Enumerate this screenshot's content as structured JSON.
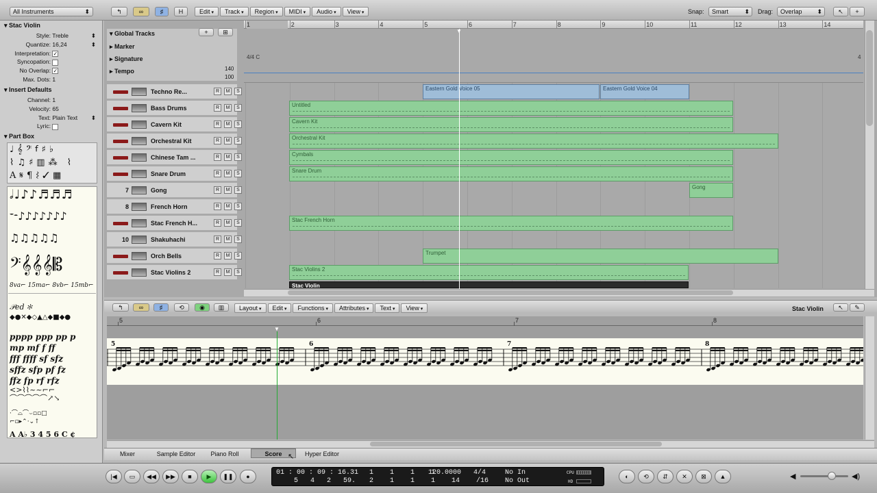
{
  "top": {
    "instruments": "All Instruments",
    "buttons": [
      "H"
    ],
    "menus": [
      "Edit",
      "Track",
      "Region",
      "MIDI",
      "Audio",
      "View"
    ],
    "snap_label": "Snap:",
    "snap": "Smart",
    "drag_label": "Drag:",
    "drag": "Overlap"
  },
  "inspector": {
    "title": "Stac Violin",
    "style_label": "Style:",
    "style": "Treble",
    "quantize_label": "Quantize:",
    "quantize": "16,24",
    "interp_label": "Interpretation:",
    "sync_label": "Syncopation:",
    "nooverlap_label": "No Overlap:",
    "maxdots_label": "Max. Dots:",
    "maxdots": "1",
    "insert_title": "Insert Defaults",
    "channel_label": "Channel:",
    "channel": "1",
    "velocity_label": "Velocity:",
    "velocity": "65",
    "text_label": "Text:",
    "text": "Plain Text",
    "lyric_label": "Lyric:",
    "partbox_title": "Part Box"
  },
  "arrange": {
    "global_tracks": "Global Tracks",
    "marker": "Marker",
    "signature": "Signature",
    "sig_value": "4/4 C",
    "sig_end": "4",
    "tempo": "Tempo",
    "tempo_hi": "140",
    "tempo_lo": "100",
    "ruler": [
      "1",
      "2",
      "3",
      "4",
      "5",
      "6",
      "7",
      "8",
      "9",
      "10",
      "11",
      "12",
      "13",
      "14"
    ],
    "tracks": [
      {
        "num": "",
        "name": "Techno Re..."
      },
      {
        "num": "",
        "name": "Bass Drums"
      },
      {
        "num": "",
        "name": "Cavern Kit"
      },
      {
        "num": "",
        "name": "Orchestral Kit"
      },
      {
        "num": "",
        "name": "Chinese Tam ..."
      },
      {
        "num": "",
        "name": "Snare Drum"
      },
      {
        "num": "7",
        "name": "Gong"
      },
      {
        "num": "8",
        "name": "French Horn"
      },
      {
        "num": "",
        "name": "Stac French H..."
      },
      {
        "num": "10",
        "name": "Shakuhachi"
      },
      {
        "num": "",
        "name": "Orch Bells"
      },
      {
        "num": "",
        "name": "Stac Violins 2"
      }
    ],
    "regions": [
      "Eastern Gold Voice 05",
      "Eastern Gold Voice 04",
      "Untitled",
      "Cavern Kit",
      "Orchestral Kit",
      "Cymbals",
      "Snare Drum",
      "Gong",
      "Stac French Horn",
      "Trumpet",
      "Stac Violins 2",
      "Stac Violin"
    ]
  },
  "score": {
    "menus": [
      "Layout",
      "Edit",
      "Functions",
      "Attributes",
      "Text",
      "View"
    ],
    "title": "Stac Violin",
    "ruler": [
      "5",
      "6",
      "7",
      "8"
    ],
    "bars": [
      "5",
      "6",
      "7",
      "8"
    ]
  },
  "tabs": [
    "Mixer",
    "Sample Editor",
    "Piano Roll",
    "Score",
    "Hyper Editor"
  ],
  "transport": {
    "time": "01 : 00 : 09 : 16.31",
    "bars": "5   4   2   59.",
    "pos1": "1    1    1    1",
    "pos2": "2    1    1    1",
    "tempo": "120.0000",
    "tempo2": "14",
    "sig": "4/4",
    "div": "/16",
    "in": "No In",
    "out": "No Out",
    "cpu": "CPU",
    "hd": "HD"
  },
  "colors": {
    "region_green": "#8fcf98",
    "region_blue": "#9fbdd8",
    "playhead": "#ffffff",
    "score_playhead": "#22aa33"
  }
}
